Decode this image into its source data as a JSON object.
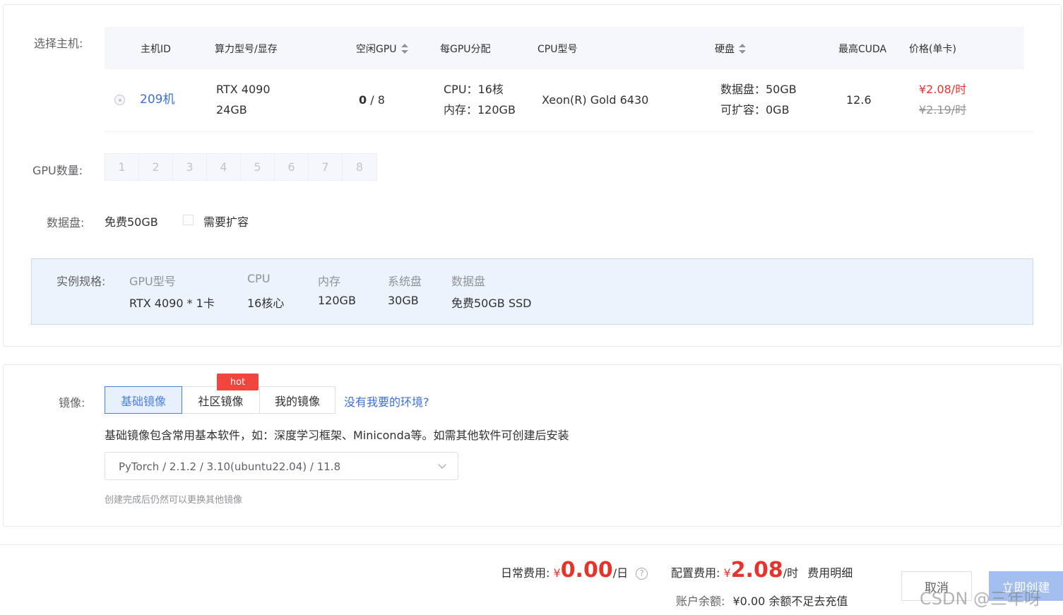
{
  "host": {
    "label": "选择主机:",
    "columns": {
      "id": "主机ID",
      "model": "算力型号/显存",
      "free_gpu": "空闲GPU",
      "per_gpu": "每GPU分配",
      "cpu_model": "CPU型号",
      "disk": "硬盘",
      "cuda": "最高CUDA",
      "price": "价格(单卡)"
    },
    "row": {
      "id": "209机",
      "model": "RTX 4090",
      "vram": "24GB",
      "free_gpu_used": "0",
      "free_gpu_total": " / 8",
      "cpu": "CPU：16核",
      "mem": "内存：120GB",
      "cpu_model": "Xeon(R) Gold 6430",
      "data_disk": "数据盘：50GB",
      "expandable": "可扩容：0GB",
      "cuda": "12.6",
      "price_now": "¥2.08/时",
      "price_old": "¥2.19/时"
    }
  },
  "gpu_count": {
    "label": "GPU数量:",
    "options": [
      "1",
      "2",
      "3",
      "4",
      "5",
      "6",
      "7",
      "8"
    ]
  },
  "data_disk": {
    "label": "数据盘:",
    "value": "免费50GB",
    "expand_label": "需要扩容"
  },
  "spec": {
    "label": "实例规格:",
    "gpu_k": "GPU型号",
    "gpu_v": "RTX 4090 * 1卡",
    "cpu_k": "CPU",
    "cpu_v": "16核心",
    "mem_k": "内存",
    "mem_v": "120GB",
    "sys_k": "系统盘",
    "sys_v": "30GB",
    "data_k": "数据盘",
    "data_v": "免费50GB SSD"
  },
  "image": {
    "label": "镜像:",
    "tabs": [
      "基础镜像",
      "社区镜像",
      "我的镜像"
    ],
    "hot_badge": "hot",
    "missing_link": "没有我要的环境?",
    "description": "基础镜像包含常用基本软件，如：深度学习框架、Miniconda等。如需其他软件可创建后安装",
    "selected": "PyTorch / 2.1.2 / 3.10(ubuntu22.04) / 11.8",
    "hint": "创建完成后仍然可以更换其他镜像"
  },
  "footer": {
    "daily_label": "日常费用:",
    "daily_symbol": "¥",
    "daily_value": "0.00",
    "daily_unit": "/日",
    "config_label": "配置费用:",
    "config_symbol": "¥",
    "config_value": "2.08",
    "config_unit": "/时",
    "fee_detail": "费用明细",
    "balance_label": "账户余额:",
    "balance_value": "¥0.00",
    "recharge_link": "余额不足去充值",
    "cancel": "取消",
    "create": "立即创建"
  },
  "watermark": "CSDN @三年呀",
  "colors": {
    "accent": "#3b6fd9",
    "price": "#e8332a",
    "spec_bg": "#edf3fc"
  }
}
